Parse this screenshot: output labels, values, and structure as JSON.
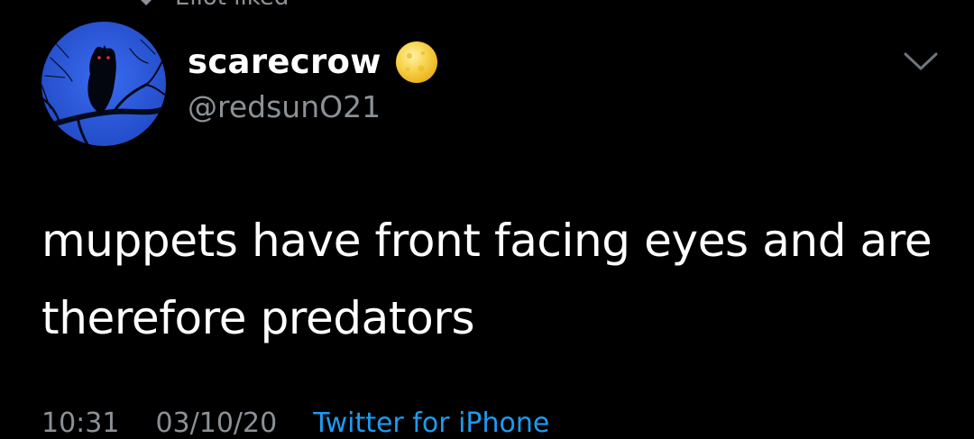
{
  "header": {
    "liked_context": "Eliot liked"
  },
  "tweet": {
    "display_name": "scarecrow",
    "handle": "@redsunO21",
    "badge_emoji": "sun-emoji",
    "text": "muppets have front facing eyes and are therefore predators",
    "time": "10:31",
    "date": "03/10/20",
    "source": "Twitter for iPhone"
  },
  "icons": {
    "avatar": "owl-silhouette-avatar",
    "menu": "chevron-down-icon",
    "liked": "heart-icon"
  },
  "colors": {
    "background": "#000000",
    "text_primary": "#ffffff",
    "text_secondary": "#8b9196",
    "accent": "#1d9bf0",
    "avatar_sky": "#2d5fe0"
  }
}
